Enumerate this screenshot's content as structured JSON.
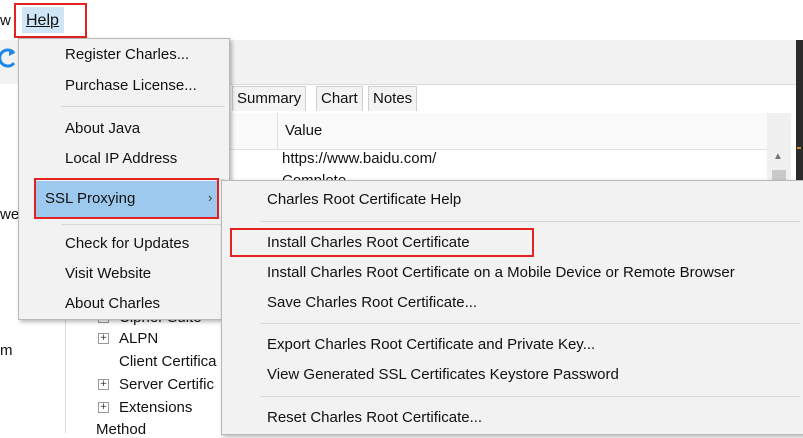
{
  "menubar": {
    "partial_item": "w",
    "help_label": "Help"
  },
  "tabs": [
    "Summary",
    "Chart",
    "Notes"
  ],
  "table": {
    "value_header": "Value",
    "rows": [
      "https://www.baidu.com/",
      "Complete"
    ]
  },
  "left_pane": {
    "fragments": [
      "we",
      "m"
    ]
  },
  "tree": [
    {
      "label": "Cipher Suite",
      "expandable": true
    },
    {
      "label": "ALPN",
      "expandable": true
    },
    {
      "label": "Client Certifica",
      "expandable": false
    },
    {
      "label": "Server Certific",
      "expandable": true
    },
    {
      "label": "Extensions",
      "expandable": true
    },
    {
      "label": "Method",
      "expandable": false
    }
  ],
  "help_menu": {
    "items": [
      "Register Charles...",
      "Purchase License...",
      "About Java",
      "Local IP Address",
      "SSL Proxying",
      "Check for Updates",
      "Visit Website",
      "About Charles"
    ],
    "submenu_arrow": "›"
  },
  "ssl_submenu": {
    "items": [
      "Charles Root Certificate Help",
      "Install Charles Root Certificate",
      "Install Charles Root Certificate on a Mobile Device or Remote Browser",
      "Save Charles Root Certificate...",
      "Export Charles Root Certificate and Private Key...",
      "View Generated SSL Certificates Keystore Password",
      "Reset Charles Root Certificate..."
    ]
  },
  "colors": {
    "highlight_box": "#e32222",
    "selected_item": "#9ec9ef",
    "menu_background": "#f2f2f2",
    "refresh_icon": "#1e88e5"
  },
  "icons": [
    "refresh-icon",
    "chevron-right-icon",
    "expand-plus-icon"
  ]
}
